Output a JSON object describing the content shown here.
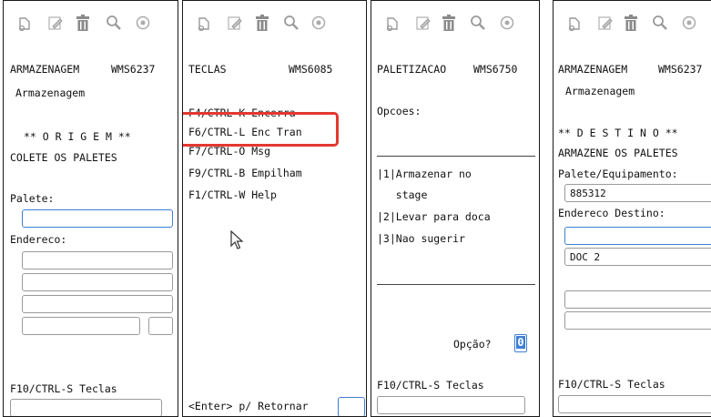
{
  "colors": {
    "border": "#1a1a1a",
    "focus": "#3d7fd6",
    "highlight": "#e3382f",
    "icon": "#9a9a9a"
  },
  "toolbar_icons": [
    "new-document-icon",
    "edit-icon",
    "delete-trash-icon",
    "search-icon",
    "circle-icon"
  ],
  "panel1": {
    "header_left": "ARMAZENAGEM",
    "header_code": "WMS6237",
    "subtitle": "Armazenagem",
    "section": "** O R I G E M **",
    "instruction": "COLETE OS PALETES",
    "palete_label": "Palete:",
    "endereco_label": "Endereco:",
    "footer": "F10/CTRL-S Teclas"
  },
  "panel2": {
    "header_left": "TECLAS",
    "header_code": "WMS6085",
    "keys": [
      "F4/CTRL-K Encerra",
      "F6/CTRL-L Enc Tran",
      "F7/CTRL-O Msg",
      "F9/CTRL-B Empilham",
      "F1/CTRL-W Help"
    ],
    "footer": "<Enter> p/ Retornar"
  },
  "panel3": {
    "header_left": "PALETIZACAO",
    "header_code": "WMS6750",
    "opcoes": "Opcoes:",
    "options": [
      "|1|Armazenar no",
      "   stage",
      "|2|Levar para doca",
      "|3|Nao sugerir"
    ],
    "option_prompt": "Opção?",
    "option_value": "0",
    "footer": "F10/CTRL-S Teclas"
  },
  "panel4": {
    "header_left": "ARMAZENAGEM",
    "header_code": "WMS6237",
    "subtitle": "Armazenagem",
    "section": "** D E S T I N O **",
    "instruction": "ARMAZENE OS PALETES",
    "palete_label": "Palete/Equipamento:",
    "palete_value": "885312",
    "endereco_label": "Endereco Destino:",
    "doc_value": "DOC 2",
    "footer": "F10/CTRL-S Teclas"
  }
}
